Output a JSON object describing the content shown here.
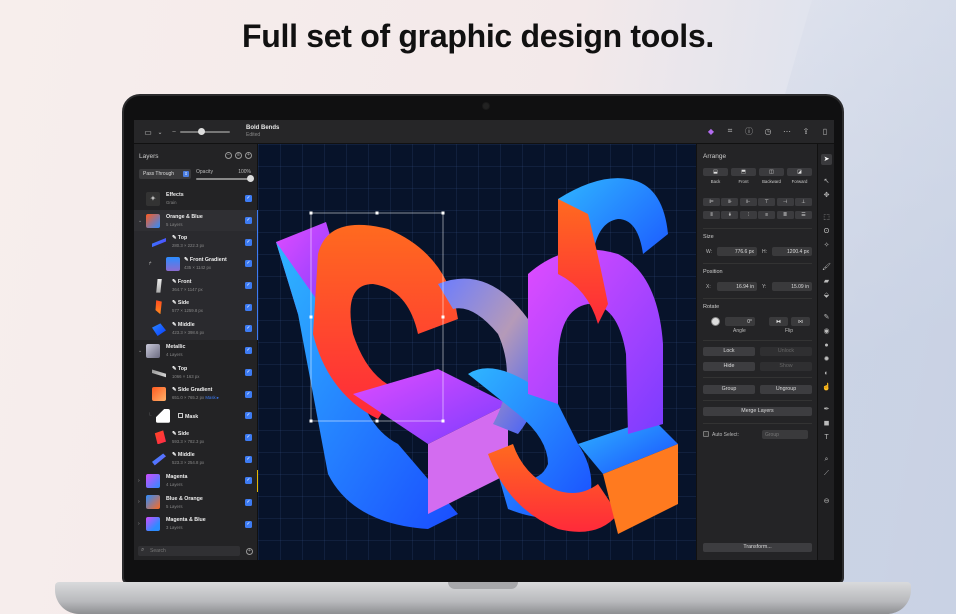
{
  "headline": "Full set of graphic design tools.",
  "window": {
    "doc_title": "Bold Bends",
    "doc_status": "Edited"
  },
  "layers_panel": {
    "title": "Layers",
    "blend_mode": "Pass Through",
    "opacity_label": "Opacity",
    "opacity_value": "100%",
    "search_placeholder": "Search",
    "items": [
      {
        "name": "Effects",
        "sub": "Grain",
        "level": 0
      },
      {
        "name": "Orange & Blue",
        "sub": "5 Layers",
        "level": 0,
        "expanded": true
      },
      {
        "name": "Top",
        "sub": "280.3 × 222.3 px",
        "level": 1
      },
      {
        "name": "Front Gradient",
        "sub": "435 × 1142 px",
        "level": 1
      },
      {
        "name": "Front",
        "sub": "364.7 × 1147 px",
        "level": 1
      },
      {
        "name": "Side",
        "sub": "577 × 1259.8 px",
        "level": 1
      },
      {
        "name": "Middle",
        "sub": "423.3 × 398.6 px",
        "level": 1
      },
      {
        "name": "Metallic",
        "sub": "4 Layers",
        "level": 0,
        "expanded": true
      },
      {
        "name": "Top",
        "sub": "1066 × 163 px",
        "level": 1
      },
      {
        "name": "Side Gradient",
        "sub": "651.0 × 765.2 px",
        "extra": "Mask ▸",
        "level": 1
      },
      {
        "name": "Mask",
        "sub": "",
        "level": 2
      },
      {
        "name": "Side",
        "sub": "593.3 × 782.3 px",
        "level": 1
      },
      {
        "name": "Middle",
        "sub": "523.3 × 254.8 px",
        "level": 1
      },
      {
        "name": "Magenta",
        "sub": "4 Layers",
        "level": 0
      },
      {
        "name": "Blue & Orange",
        "sub": "5 Layers",
        "level": 0
      },
      {
        "name": "Magenta & Blue",
        "sub": "3 Layers",
        "level": 0
      }
    ]
  },
  "arrange_panel": {
    "title": "Arrange",
    "order_buttons": [
      "Back",
      "Front",
      "Backward",
      "Forward"
    ],
    "size_label": "Size",
    "width_label": "W:",
    "width_value": "776.6 px",
    "height_label": "H:",
    "height_value": "1200.4 px",
    "position_label": "Position",
    "x_label": "X:",
    "x_value": "16.94 in",
    "y_label": "Y:",
    "y_value": "15.09 in",
    "rotate_label": "Rotate",
    "angle_value": "0°",
    "angle_label": "Angle",
    "flip_label": "Flip",
    "lock": "Lock",
    "unlock": "Unlock",
    "hide": "Hide",
    "show": "Show",
    "group": "Group",
    "ungroup": "Ungroup",
    "merge": "Merge Layers",
    "auto_select_label": "Auto Select:",
    "auto_select_value": "Group",
    "transform": "Transform..."
  },
  "colors": {
    "accent": "#3d7bf3",
    "canvas_bg": "#07132a"
  }
}
